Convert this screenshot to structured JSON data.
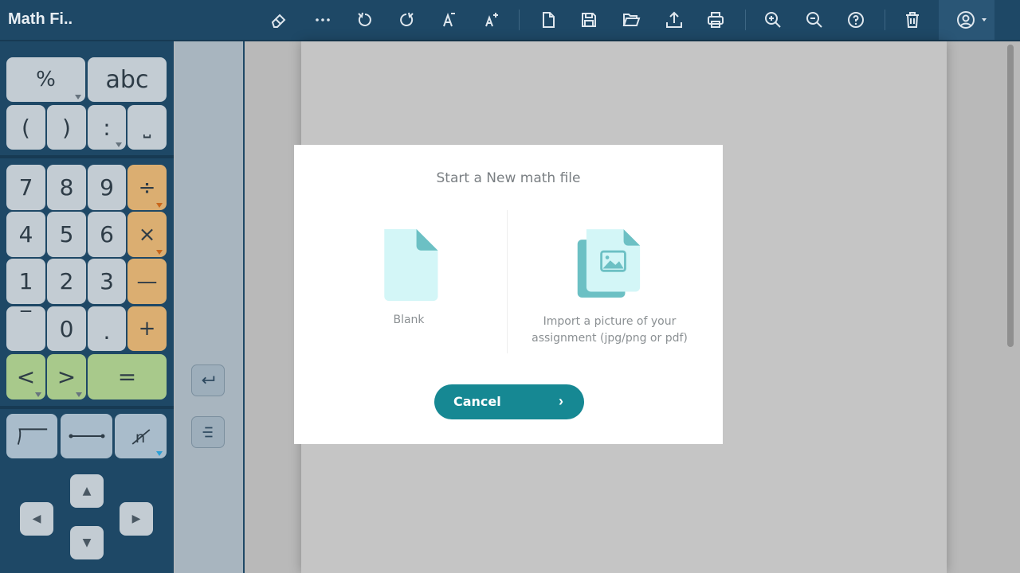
{
  "app": {
    "title": "Math Fi.."
  },
  "toolbar": {
    "icons": [
      "eraser-icon",
      "more-icon",
      "undo-icon",
      "redo-icon",
      "font-decrease-icon",
      "font-increase-icon",
      "new-file-icon",
      "save-icon",
      "open-folder-icon",
      "upload-icon",
      "print-icon",
      "zoom-in-icon",
      "zoom-out-icon",
      "help-icon",
      "trash-icon",
      "user-icon"
    ]
  },
  "keypad": {
    "row1": [
      "%",
      "abc"
    ],
    "row2": [
      "(",
      ")",
      ":",
      "⎵"
    ],
    "digits": {
      "r1": [
        "7",
        "8",
        "9",
        "÷"
      ],
      "r2": [
        "4",
        "5",
        "6",
        "×"
      ],
      "r3": [
        "1",
        "2",
        "3",
        "—"
      ],
      "r4": [
        "‾",
        "0",
        ".",
        "+"
      ],
      "r5": [
        "<",
        ">",
        "="
      ]
    },
    "arrows": [
      "▲",
      "◀",
      "▶",
      "▼"
    ]
  },
  "modal": {
    "title": "Start a New math file",
    "blank_label": "Blank",
    "import_label_line1": "Import a picture of your",
    "import_label_line2": "assignment (jpg/png or pdf)",
    "cancel_label": "Cancel",
    "cancel_chevron": "›"
  },
  "colors": {
    "toolbar_bg": "#1e4866",
    "accent_teal": "#168893",
    "key_gray": "#c3ccd3",
    "key_orange": "#dbae71",
    "key_green": "#a8c98b",
    "key_blue": "#a9bccb"
  }
}
